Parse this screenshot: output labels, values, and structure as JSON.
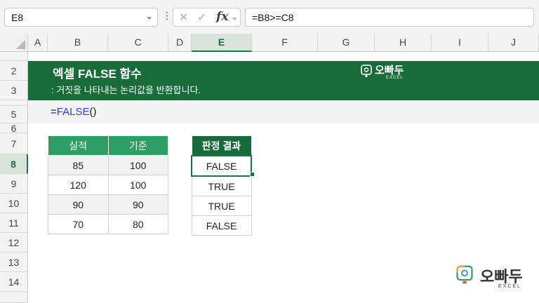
{
  "formula_bar": {
    "name_box": "E8",
    "more_glyph": "⋮",
    "cancel_glyph": "✕",
    "enter_glyph": "✓",
    "fx_label": "fx",
    "formula": "=B8>=C8"
  },
  "columns": [
    "A",
    "B",
    "C",
    "D",
    "E",
    "F",
    "G",
    "H",
    "I",
    "J"
  ],
  "rows": [
    "2",
    "3",
    "5",
    "6",
    "7",
    "8",
    "9",
    "10",
    "11",
    "12",
    "13",
    "14"
  ],
  "selected_cell": "E8",
  "banner": {
    "title": "엑셀 FALSE 함수",
    "subtitle": ": 거짓을 나타내는 논리값을 반환합니다.",
    "logo_text": "오빠두",
    "logo_sub": "EXCEL",
    "color": "#1a6b3a"
  },
  "example_formula": {
    "eq": "=",
    "fn": "FALSE",
    "parens": "()"
  },
  "data_table": {
    "headers": [
      "실적",
      "기준"
    ],
    "rows": [
      [
        "85",
        "100"
      ],
      [
        "120",
        "100"
      ],
      [
        "90",
        "90"
      ],
      [
        "70",
        "80"
      ]
    ]
  },
  "result_table": {
    "header": "판정 결과",
    "values": [
      "FALSE",
      "TRUE",
      "TRUE",
      "FALSE"
    ]
  },
  "footer_logo": {
    "text": "오빠두",
    "sub": "EXCEL"
  },
  "colors": {
    "header_green": "#2e9e63",
    "dark_green": "#156b3a",
    "function_blue": "#1f4cd6"
  }
}
